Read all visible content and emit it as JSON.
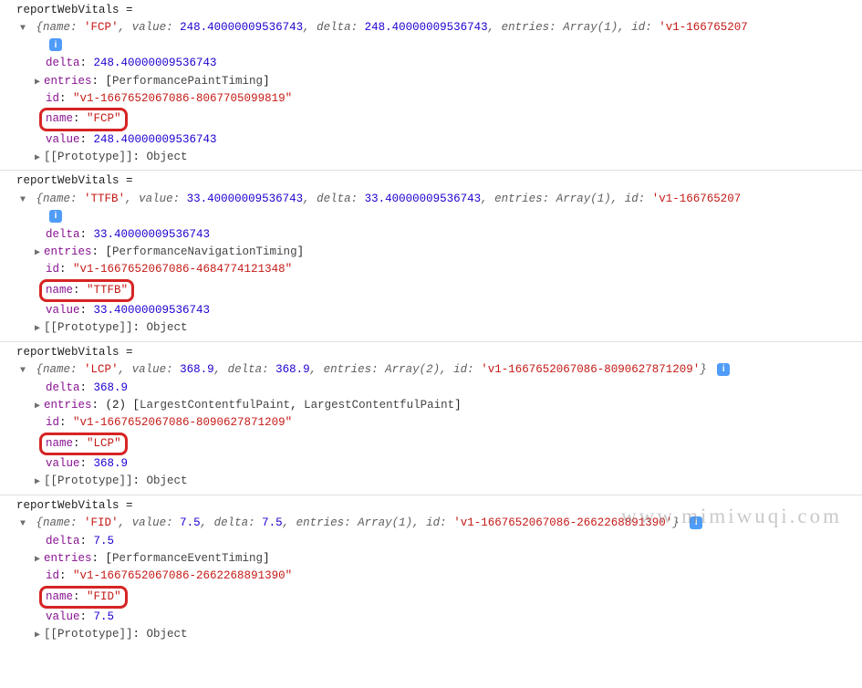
{
  "watermark": "www.mimiwuqi.com",
  "func_name": "reportWebVitals",
  "equals": " = ",
  "info_label": "i",
  "entries_type_1": "PerformancePaintTiming",
  "entries_type_2": "PerformanceNavigationTiming",
  "entries_type_3_a": "LargestContentfulPaint",
  "entries_type_3_b": "LargestContentfulPaint",
  "entries_type_4": "PerformanceEventTiming",
  "proto_label": "[[Prototype]]",
  "proto_val": "Object",
  "e1": {
    "name": "FCP",
    "value": "248.40000009536743",
    "delta": "248.40000009536743",
    "entries_summary": "Array(1)",
    "id_short": "'v1-166765207",
    "id_exp": "\"v1-1667652067086-8067705099819\"",
    "delta_exp": "248.40000009536743",
    "value_exp": "248.40000009536743"
  },
  "e2": {
    "name": "TTFB",
    "value": "33.40000009536743",
    "delta": "33.40000009536743",
    "entries_summary": "Array(1)",
    "id_short": "'v1-166765207",
    "id_exp": "\"v1-1667652067086-4684774121348\"",
    "delta_exp": "33.40000009536743",
    "value_exp": "33.40000009536743"
  },
  "e3": {
    "name": "LCP",
    "value": "368.9",
    "delta": "368.9",
    "entries_summary": "Array(2)",
    "id_full": "'v1-1667652067086-8090627871209'",
    "id_exp": "\"v1-1667652067086-8090627871209\"",
    "delta_exp": "368.9",
    "value_exp": "368.9"
  },
  "e4": {
    "name": "FID",
    "value": "7.5",
    "delta": "7.5",
    "entries_summary": "Array(1)",
    "id_full": "'v1-1667652067086-2662268891390'",
    "id_exp": "\"v1-1667652067086-2662268891390\"",
    "delta_exp": "7.5",
    "value_exp": "7.5"
  }
}
